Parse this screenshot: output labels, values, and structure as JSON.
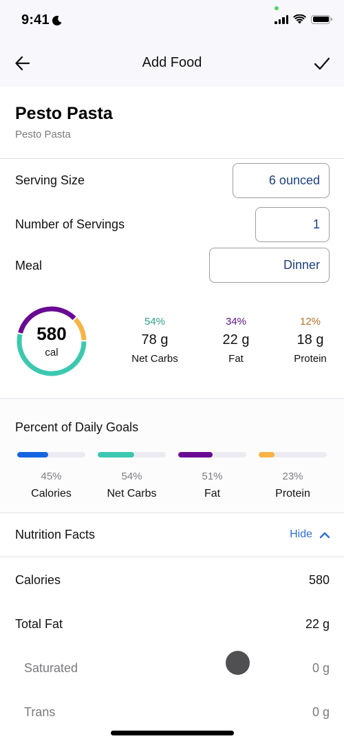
{
  "status_bar": {
    "time": "9:41",
    "icons": [
      "moon-icon",
      "signal-icon",
      "wifi-icon",
      "battery-icon"
    ]
  },
  "nav": {
    "title": "Add Food",
    "back_icon": "arrow-left-icon",
    "confirm_icon": "checkmark-icon"
  },
  "food": {
    "name": "Pesto Pasta",
    "subtitle": "Pesto Pasta"
  },
  "fields": [
    {
      "label": "Serving Size",
      "value": "6 ounced"
    },
    {
      "label": "Number of Servings",
      "value": "1"
    },
    {
      "label": "Meal",
      "value": "Dinner"
    }
  ],
  "summary": {
    "calories": "580",
    "calories_unit": "cal",
    "macros": [
      {
        "key": "carbs",
        "percent": "54%",
        "percent_value": 54,
        "grams": "78 g",
        "name": "Net Carbs",
        "color": "#3CC8B0",
        "text_color": "#2E9E86"
      },
      {
        "key": "fat",
        "percent": "34%",
        "percent_value": 34,
        "grams": "22 g",
        "name": "Fat",
        "color": "#6A0A94",
        "text_color": "#5E1485"
      },
      {
        "key": "protein",
        "percent": "12%",
        "percent_value": 12,
        "grams": "18 g",
        "name": "Protein",
        "color": "#F6B447",
        "text_color": "#B0722A"
      }
    ]
  },
  "daily_goals": {
    "title": "Percent of Daily Goals",
    "items": [
      {
        "name": "Calories",
        "percent": "45%",
        "fraction": 0.45,
        "color": "#1565E0"
      },
      {
        "name": "Net Carbs",
        "percent": "54%",
        "fraction": 0.54,
        "color": "#3CC8B0"
      },
      {
        "name": "Fat",
        "percent": "51%",
        "fraction": 0.51,
        "color": "#6A0A94"
      },
      {
        "name": "Protein",
        "percent": "23%",
        "fraction": 0.23,
        "color": "#F6B447"
      }
    ]
  },
  "nutrition_facts": {
    "title": "Nutrition Facts",
    "toggle_label": "Hide",
    "toggle_icon": "chevron-up-icon",
    "rows": [
      {
        "label": "Calories",
        "value": "580",
        "sub": false
      },
      {
        "label": "Total Fat",
        "value": "22 g",
        "sub": false
      },
      {
        "label": "Saturated",
        "value": "0 g",
        "sub": true
      },
      {
        "label": "Trans",
        "value": "0 g",
        "sub": true
      }
    ]
  },
  "colors": {
    "accent": "#2F6FD6",
    "input_text": "#1C3F7D",
    "header_bg": "#F8F7FC"
  }
}
